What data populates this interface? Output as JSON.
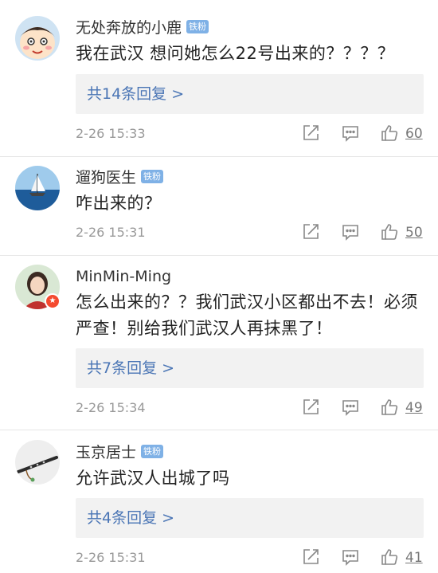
{
  "comments": [
    {
      "username": "无处奔放的小鹿",
      "badge": "铁粉",
      "avatar": "cartoon-character-avatar",
      "text": "我在武汉 想问她怎么22号出来的？？？？",
      "reply_link": "共14条回复 >",
      "time": "2-26 15:33",
      "likes": "60"
    },
    {
      "username": "遛狗医生",
      "badge": "铁粉",
      "avatar": "sailboat-avatar",
      "text": "咋出来的？",
      "reply_link": "",
      "time": "2-26 15:31",
      "likes": "50"
    },
    {
      "username": "MinMin-Ming",
      "badge": "",
      "avatar": "woman-photo-avatar",
      "text": "怎么出来的？？我们武汉小区都出不去！必须严查！别给我们武汉人再抹黑了！",
      "reply_link": "共7条回复 >",
      "time": "2-26 15:34",
      "likes": "49"
    },
    {
      "username": "玉京居士",
      "badge": "铁粉",
      "avatar": "bamboo-flute-avatar",
      "text": "允许武汉人出城了吗",
      "reply_link": "共4条回复 >",
      "time": "2-26 15:31",
      "likes": "41"
    }
  ],
  "colors": {
    "link": "#4a75b5",
    "fan_badge": "#7fb1e6",
    "meta_text": "#999999",
    "reply_bg": "#f2f2f2"
  },
  "icons": [
    "share-icon",
    "comment-icon",
    "like-icon"
  ]
}
